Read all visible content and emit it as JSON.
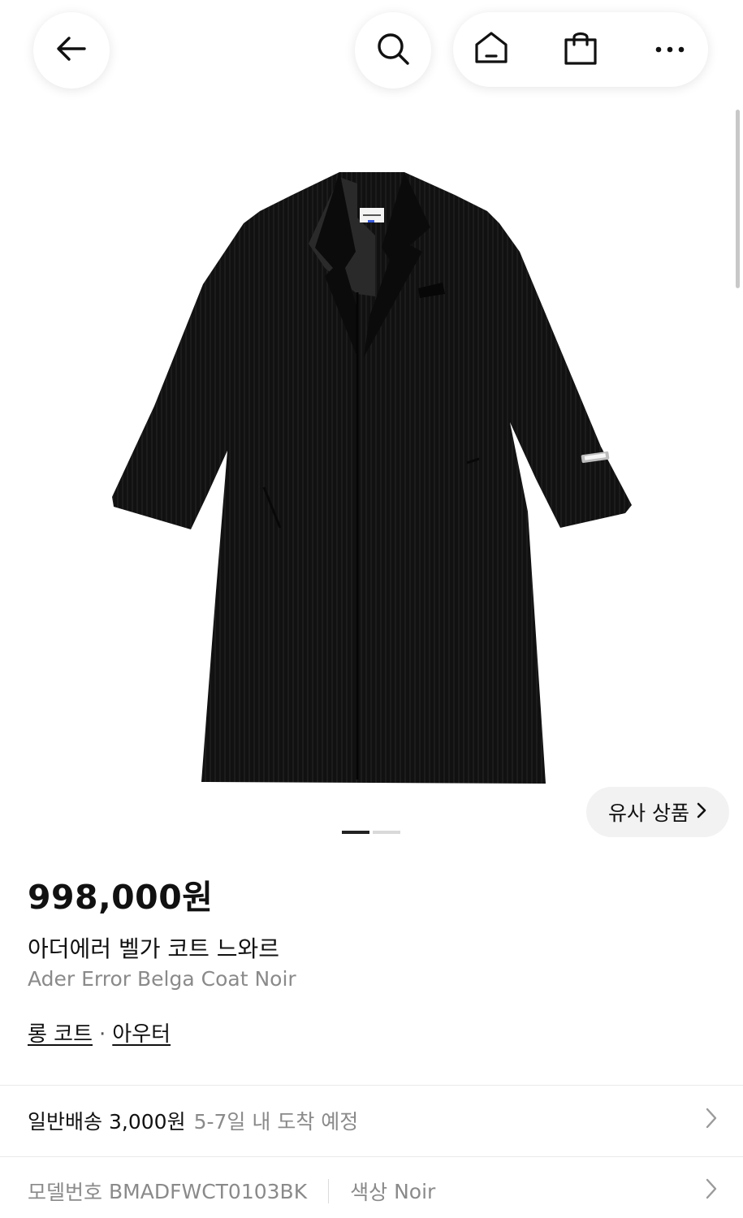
{
  "header": {
    "back_icon": "arrow-left-icon",
    "search_icon": "search-icon",
    "home_icon": "home-icon",
    "cart_icon": "shopping-bag-icon",
    "more_icon": "more-horizontal-icon"
  },
  "gallery": {
    "image_alt": "black corduroy long coat",
    "similar_button_label": "유사 상품",
    "pages_total": 2,
    "current_page": 1,
    "colors": {
      "active_dot": "#222222",
      "inactive_dot": "#d9d9d9"
    }
  },
  "product": {
    "price": "998,000원",
    "name_ko": "아더에러 벨가 코트 느와르",
    "name_en": "Ader Error Belga Coat Noir",
    "categories": [
      "롱 코트",
      "아우터"
    ],
    "category_separator": "·"
  },
  "shipping": {
    "label": "일반배송",
    "fee": "3,000원",
    "eta": "5-7일 내 도착 예정"
  },
  "details": {
    "model_label": "모델번호",
    "model_value": "BMADFWCT0103BK",
    "color_label": "색상",
    "color_value": "Noir"
  }
}
